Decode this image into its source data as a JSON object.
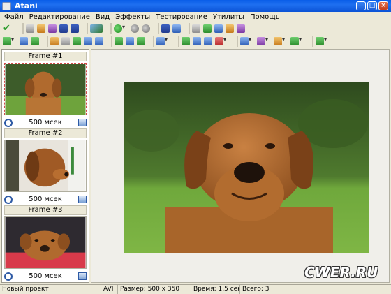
{
  "window": {
    "title": "Atani"
  },
  "menu": [
    "Файл",
    "Редактирование",
    "Вид",
    "Эффекты",
    "Тестирование",
    "Утилиты",
    "Помощь"
  ],
  "toolbar1": {
    "groups": [
      [
        "apply-check-icon"
      ],
      [
        "open-icon",
        "reload-icon",
        "wizard-icon",
        "save-icon",
        "save-as-icon"
      ],
      [
        "export-icon"
      ],
      [
        "play-icon",
        "pause-icon",
        "stop-icon"
      ],
      [
        "save-frame-icon",
        "copy-frame-icon"
      ],
      [
        "resize-icon",
        "image-import-icon",
        "film-icon",
        "frame-grid-icon",
        "slideshow-icon"
      ]
    ]
  },
  "toolbar2": {
    "groups": [
      [
        "add-frame-icon",
        "delete-frame-icon",
        "duplicate-frame-icon"
      ],
      [
        "move-up-icon",
        "move-left-icon",
        "move-right-icon",
        "timer-icon",
        "properties-icon"
      ],
      [
        "crop-icon",
        "merge-icon",
        "split-icon"
      ],
      [
        "layout-icon"
      ],
      [
        "layer-icon",
        "frame-icon",
        "fill-icon",
        "stamp-icon"
      ],
      [
        "align-icon",
        "distribute-icon",
        "order-icon",
        "effect-icon"
      ],
      [
        "color-icon"
      ]
    ]
  },
  "frames": [
    {
      "title": "Frame #1",
      "duration": "500 мсек",
      "selected": true
    },
    {
      "title": "Frame #2",
      "duration": "500 мсек",
      "selected": false
    },
    {
      "title": "Frame #3",
      "duration": "500 мсек",
      "selected": false
    }
  ],
  "status": {
    "project": "Новый проект",
    "format": "AVI",
    "size": "Размер: 500 x 350",
    "time": "Время: 1,5 сек",
    "total": "Всего: 3"
  },
  "watermark": "CWER.RU"
}
